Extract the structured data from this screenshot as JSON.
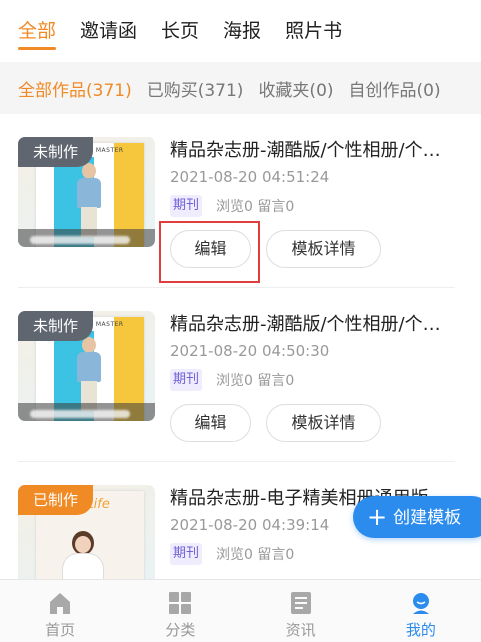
{
  "tabs": [
    {
      "label": "全部"
    },
    {
      "label": "邀请函"
    },
    {
      "label": "长页"
    },
    {
      "label": "海报"
    },
    {
      "label": "照片书"
    }
  ],
  "filters": [
    {
      "label": "全部作品(371)"
    },
    {
      "label": "已购买(371)"
    },
    {
      "label": "收藏夹(0)"
    },
    {
      "label": "自创作品(0)"
    }
  ],
  "works": [
    {
      "badge": "未制作",
      "title": "精品杂志册-潮酷版/个性相册/个性写真集",
      "date": "2021-08-20 04:51:24",
      "tag": "期刊",
      "stats": "浏览0 留言0",
      "edit_label": "编辑",
      "detail_label": "模板详情",
      "poster_text": "THE MASTER"
    },
    {
      "badge": "未制作",
      "title": "精品杂志册-潮酷版/个性相册/个性写真集",
      "date": "2021-08-20 04:50:30",
      "tag": "期刊",
      "stats": "浏览0 留言0",
      "edit_label": "编辑",
      "detail_label": "模板详情",
      "poster_text": "THE MASTER"
    },
    {
      "badge": "已制作",
      "title": "精品杂志册-电子精美相册通用版",
      "date": "2021-08-20 04:39:14",
      "tag": "期刊",
      "stats": "浏览0 留言0",
      "poster_text": "d Life"
    }
  ],
  "fab": {
    "label": "创建模板"
  },
  "nav": [
    {
      "label": "首页"
    },
    {
      "label": "分类"
    },
    {
      "label": "资讯"
    },
    {
      "label": "我的"
    }
  ],
  "colors": {
    "accent": "#f08a24",
    "primary": "#2b8cee",
    "badge_gray": "#5f6670",
    "highlight": "#e03d3d"
  }
}
